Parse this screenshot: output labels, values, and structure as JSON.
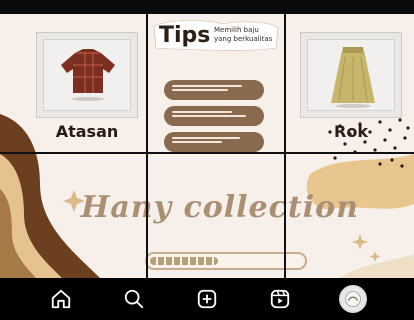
{
  "tiles": {
    "left_label": "Atasan",
    "right_label": "Rok",
    "tips_title": "Tips",
    "tips_subtitle_line1": "Memilih baju",
    "tips_subtitle_line2": "yang berkualitas"
  },
  "brand": {
    "name": "Hany collection",
    "loading_progress": 0.45
  },
  "nav": {
    "items": [
      {
        "name": "home"
      },
      {
        "name": "search"
      },
      {
        "name": "create"
      },
      {
        "name": "reels"
      },
      {
        "name": "profile"
      }
    ]
  },
  "colors": {
    "background": "#f7efe9",
    "brown_dark": "#6b3f1f",
    "brown_mid": "#a67a47",
    "cream": "#e5c28f",
    "pill": "#8a6a4f",
    "brand_text": "#a98f74"
  }
}
